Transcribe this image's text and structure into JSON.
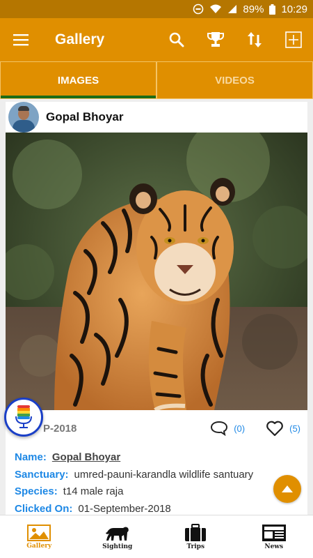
{
  "status_bar": {
    "battery": "89%",
    "time": "10:29"
  },
  "app_bar": {
    "title": "Gallery",
    "icons": [
      "menu-icon",
      "search-icon",
      "trophy-icon",
      "sort-icon",
      "add-box-icon"
    ]
  },
  "tabs": [
    {
      "label": "IMAGES",
      "active": true
    },
    {
      "label": "VIDEOS",
      "active": false
    }
  ],
  "post": {
    "user_name": "Gopal Bhoyar",
    "date": "P-2018",
    "comments": "(0)",
    "likes": "(5)",
    "details": [
      {
        "label": "Name:",
        "value": "Gopal Bhoyar",
        "link": true
      },
      {
        "label": "Sanctuary:",
        "value": "umred-pauni-karandla wildlife santuary"
      },
      {
        "label": "Species:",
        "value": "t14 male raja"
      },
      {
        "label": "Clicked On:",
        "value": "01-September-2018"
      }
    ]
  },
  "bottom_nav": [
    {
      "label": "Gallery",
      "icon": "gallery-icon",
      "active": true
    },
    {
      "label": "Sighting",
      "icon": "tiger-icon",
      "active": false
    },
    {
      "label": "Trips",
      "icon": "suitcase-icon",
      "active": false
    },
    {
      "label": "News",
      "icon": "newspaper-icon",
      "active": false
    }
  ],
  "colors": {
    "primary": "#e08f00",
    "status_bar": "#b57600",
    "accent_text": "#1e88e5",
    "tab_indicator": "#1d6b15",
    "mic_ring": "#1a3fc7"
  }
}
